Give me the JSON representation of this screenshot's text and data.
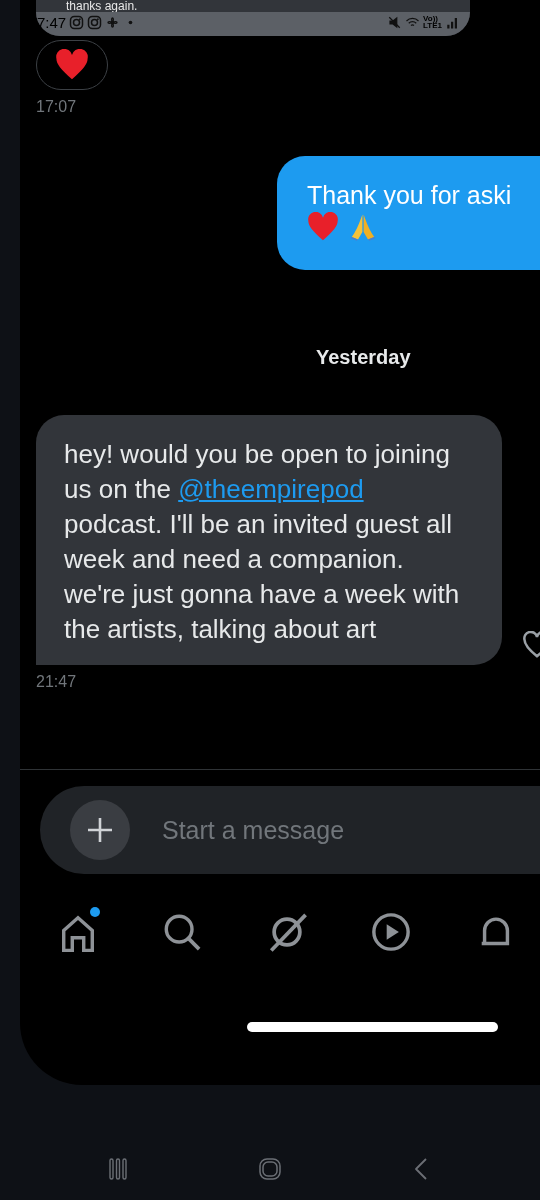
{
  "messages_top": {
    "text": "thanks again.",
    "status_bar": {
      "time": "7:47",
      "network_top": "Vo))",
      "network_bottom": "LTE1"
    }
  },
  "reaction": {
    "time": "17:07"
  },
  "sent": {
    "text": "Thank you for aski"
  },
  "date_divider": "Yesterday",
  "received": {
    "parts": [
      {
        "kind": "text",
        "text": "hey! would you be open to joining us on the "
      },
      {
        "kind": "mention",
        "text": "@theempirepod"
      },
      {
        "kind": "text",
        "text": " podcast. I'll be an invited guest all week and need a companion. we're just gonna have a week with the artists, talking about art"
      }
    ],
    "time": "21:47",
    "liked": false
  },
  "composer": {
    "placeholder": "Start a message"
  },
  "tab_bar": [
    {
      "kind": "home",
      "badge": true
    },
    {
      "kind": "search",
      "badge": false
    },
    {
      "kind": "grok",
      "badge": false
    },
    {
      "kind": "video",
      "badge": false
    },
    {
      "kind": "notifications",
      "badge": false
    }
  ]
}
